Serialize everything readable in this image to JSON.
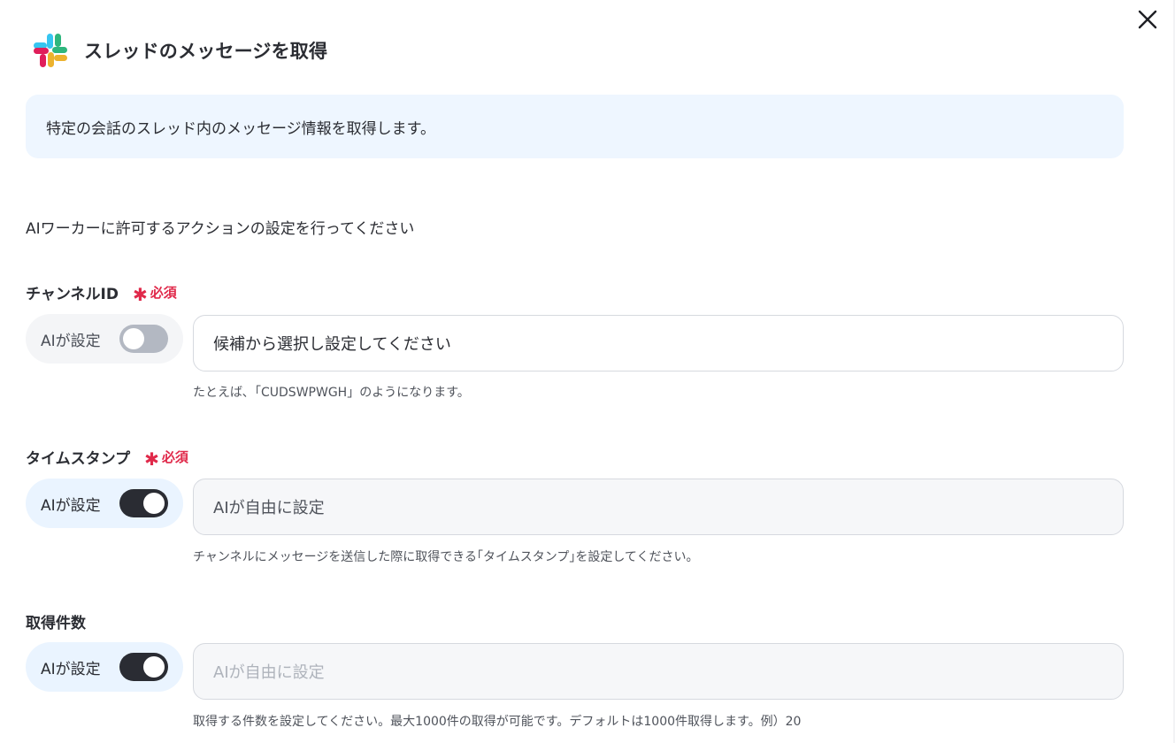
{
  "dialog": {
    "close_icon": "close-icon",
    "title": "スレッドのメッセージを取得",
    "logo_icon": "slack-logo-icon",
    "description": "特定の会話のスレッド内のメッセージ情報を取得します。",
    "intro": "AIワーカーに許可するアクションの設定を行ってください"
  },
  "colors": {
    "slack_blue": "#36c5f0",
    "slack_green": "#2eb67d",
    "slack_yellow": "#ecb22e",
    "slack_red": "#e01e5a",
    "required": "#e0294a",
    "toggle_on": "#2a2c33",
    "toggle_off": "#b3b8c2"
  },
  "fields": [
    {
      "label": "チャンネルID",
      "required_label": "必須",
      "ai_label": "AIが設定",
      "ai_enabled": false,
      "value": "候補から選択し設定してください",
      "hint": "たとえば､「CUDSWPWGH」のようになります。"
    },
    {
      "label": "タイムスタンプ",
      "required_label": "必須",
      "ai_label": "AIが設定",
      "ai_enabled": true,
      "value": "AIが自由に設定",
      "hint": "チャンネルにメッセージを送信した際に取得できる｢タイムスタンプ｣を設定してください。"
    },
    {
      "label": "取得件数",
      "ai_label": "AIが設定",
      "ai_enabled": true,
      "placeholder": "AIが自由に設定",
      "hint": "取得する件数を設定してください。最大1000件の取得が可能です。デフォルトは1000件取得します。例）20"
    }
  ]
}
